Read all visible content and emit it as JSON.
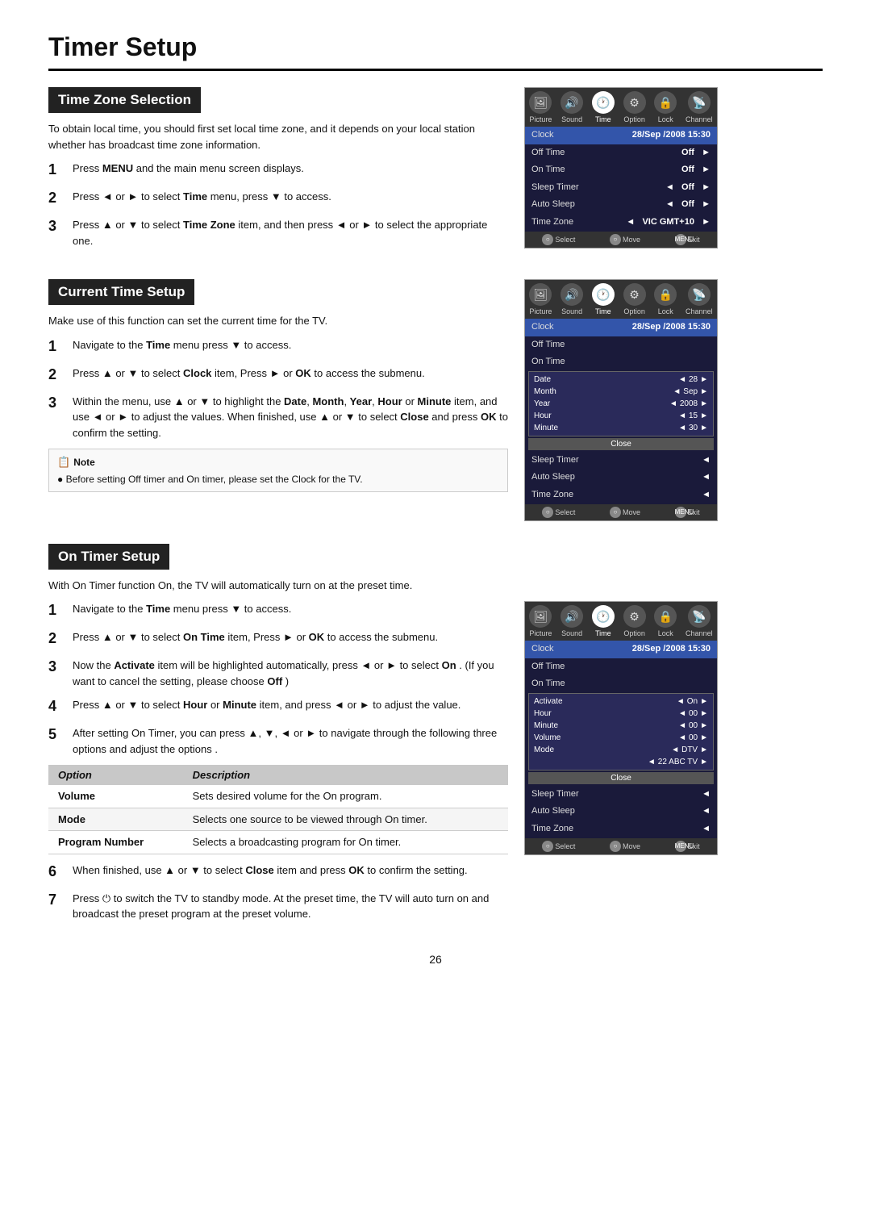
{
  "page": {
    "title": "Timer Setup",
    "page_number": "26"
  },
  "sections": {
    "time_zone": {
      "header": "Time Zone Selection",
      "intro": "To obtain local time, you should first set local time zone, and it depends on your local station whether has broadcast time zone information.",
      "steps": [
        {
          "num": "1",
          "html": "Press <b>MENU</b> and the main menu screen displays."
        },
        {
          "num": "2",
          "html": "Press ◄ or ► to select <b>Time</b> menu,  press ▼  to access."
        },
        {
          "num": "3",
          "html": "Press ▲ or ▼ to select <b>Time Zone</b> item, and then press ◄ or ► to select the appropriate one."
        }
      ]
    },
    "current_time": {
      "header": "Current Time Setup",
      "intro": "Make use of this function can set the current time for the TV.",
      "steps": [
        {
          "num": "1",
          "html": "Navigate to the <b>Time</b> menu  press ▼  to access."
        },
        {
          "num": "2",
          "html": "Press ▲ or ▼ to select <b>Clock</b> item, Press ► or <b>OK</b> to access the submenu."
        },
        {
          "num": "3",
          "html": "Within the menu, use ▲ or ▼ to highlight the <b>Date</b>, <b>Month</b>, <b>Year</b>, <b>Hour</b> or <b>Minute</b> item, and use ◄ or ► to adjust the values. When finished, use ▲ or ▼ to select <b>Close</b> and press <b>OK</b> to confirm the setting."
        }
      ],
      "note": {
        "title": "Note",
        "text": "Before setting Off timer and On timer, please set the Clock for the TV."
      }
    },
    "on_timer": {
      "header": "On Timer Setup",
      "intro": "With On Timer function On, the TV will automatically turn on at the preset time.",
      "steps": [
        {
          "num": "1",
          "html": "Navigate to the <b>Time</b> menu  press ▼  to access."
        },
        {
          "num": "2",
          "html": "Press ▲ or ▼ to select <b>On Time</b> item, Press ► or <b>OK</b> to access the submenu."
        },
        {
          "num": "3",
          "html": "Now the <b>Activate</b> item will be highlighted automatically, press ◄ or ► to select <b>On</b> . (If you want to cancel the setting, please choose <b>Off</b> )"
        },
        {
          "num": "4",
          "html": "Press ▲ or ▼ to select <b>Hour</b> or <b>Minute</b> item, and press ◄ or ► to adjust the value."
        },
        {
          "num": "5",
          "html": "After setting On Timer, you can press ▲, ▼, ◄ or ► to navigate through the following three options and adjust the options ."
        }
      ],
      "option_table": {
        "headers": [
          "Option",
          "Description"
        ],
        "rows": [
          {
            "option": "Volume",
            "desc": "Sets desired volume for the On program."
          },
          {
            "option": "Mode",
            "desc": "Selects one source to be viewed through On timer."
          },
          {
            "option": "Program Number",
            "desc": "Selects a broadcasting program for On timer."
          }
        ]
      },
      "steps_after": [
        {
          "num": "6",
          "html": "When finished, use ▲ or ▼ to select <b>Close</b> item and press <b>OK</b> to confirm the setting."
        },
        {
          "num": "7",
          "html": "Press ⏻ to switch the TV to standby mode. At the preset time, the TV will auto turn on and broadcast the preset program at the preset volume."
        }
      ]
    }
  },
  "tv_menus": {
    "menu1": {
      "icons": [
        "Picture",
        "Sound",
        "Time",
        "Option",
        "Lock",
        "Channel"
      ],
      "active_icon": "Time",
      "rows": [
        {
          "label": "Clock",
          "value": "28/Sep /2008 15:30",
          "colspan": true
        },
        {
          "label": "Off Time",
          "value": "Off",
          "arrow": "►"
        },
        {
          "label": "On Time",
          "value": "Off",
          "arrow": "►"
        },
        {
          "label": "Sleep Timer",
          "arrow_left": "◄",
          "value": "Off",
          "arrow": "►"
        },
        {
          "label": "Auto Sleep",
          "arrow_left": "◄",
          "value": "Off",
          "arrow": "►"
        },
        {
          "label": "Time Zone",
          "arrow_left": "◄",
          "value": "VIC GMT+10",
          "arrow": "►"
        }
      ],
      "footer": [
        "Select",
        "Move",
        "Exit"
      ]
    },
    "menu2": {
      "icons": [
        "Picture",
        "Sound",
        "Time",
        "Option",
        "Lock",
        "Channel"
      ],
      "active_icon": "Time",
      "rows": [
        {
          "label": "Clock",
          "value": "28/Sep /2008 15:30",
          "colspan": true
        },
        {
          "label": "Off Time",
          "value": "",
          "arrow": ""
        },
        {
          "label": "On Time",
          "value": "",
          "arrow": ""
        },
        {
          "label": "Sleep Timer",
          "arrow_left": "◄",
          "value": "",
          "arrow": ""
        },
        {
          "label": "Auto Sleep",
          "arrow_left": "◄",
          "value": "",
          "arrow": ""
        },
        {
          "label": "Time Zone",
          "arrow_left": "◄",
          "value": "",
          "arrow": ""
        }
      ],
      "submenu": [
        {
          "label": "Date",
          "arrow_left": "◄",
          "value": "28",
          "arrow": "►"
        },
        {
          "label": "Month",
          "arrow_left": "◄",
          "value": "Sep",
          "arrow": "►"
        },
        {
          "label": "Year",
          "arrow_left": "◄",
          "value": "2008",
          "arrow": "►"
        },
        {
          "label": "Hour",
          "arrow_left": "◄",
          "value": "15",
          "arrow": "►"
        },
        {
          "label": "Minute",
          "arrow_left": "◄",
          "value": "30",
          "arrow": "►"
        }
      ],
      "footer": [
        "Select",
        "Move",
        "Exit"
      ]
    },
    "menu3": {
      "icons": [
        "Picture",
        "Sound",
        "Time",
        "Option",
        "Lock",
        "Channel"
      ],
      "active_icon": "Time",
      "rows": [
        {
          "label": "Clock",
          "value": "28/Sep /2008 15:30",
          "colspan": true
        },
        {
          "label": "Off Time",
          "value": "",
          "arrow": ""
        },
        {
          "label": "On Time",
          "value": "",
          "arrow": ""
        },
        {
          "label": "Sleep Timer",
          "arrow_left": "◄",
          "value": "",
          "arrow": ""
        },
        {
          "label": "Auto Sleep",
          "arrow_left": "◄",
          "value": "",
          "arrow": ""
        },
        {
          "label": "Time Zone",
          "arrow_left": "◄",
          "value": "",
          "arrow": ""
        }
      ],
      "submenu": [
        {
          "label": "Activate",
          "arrow_left": "◄",
          "value": "On",
          "arrow": "►"
        },
        {
          "label": "Hour",
          "arrow_left": "◄",
          "value": "00",
          "arrow": "►"
        },
        {
          "label": "Minute",
          "arrow_left": "◄",
          "value": "00",
          "arrow": "►"
        },
        {
          "label": "Volume",
          "arrow_left": "◄",
          "value": "00",
          "arrow": "►"
        },
        {
          "label": "Mode",
          "arrow_left": "◄",
          "value": "DTV",
          "arrow": "►"
        },
        {
          "label": "",
          "arrow_left": "◄",
          "value": "22 ABC TV",
          "arrow": "►"
        }
      ],
      "footer": [
        "Select",
        "Move",
        "Exit"
      ]
    }
  },
  "icons": {
    "picture": "🖼",
    "sound": "🔊",
    "time": "🕐",
    "option": "⚙",
    "lock": "🔒",
    "channel": "📡"
  }
}
